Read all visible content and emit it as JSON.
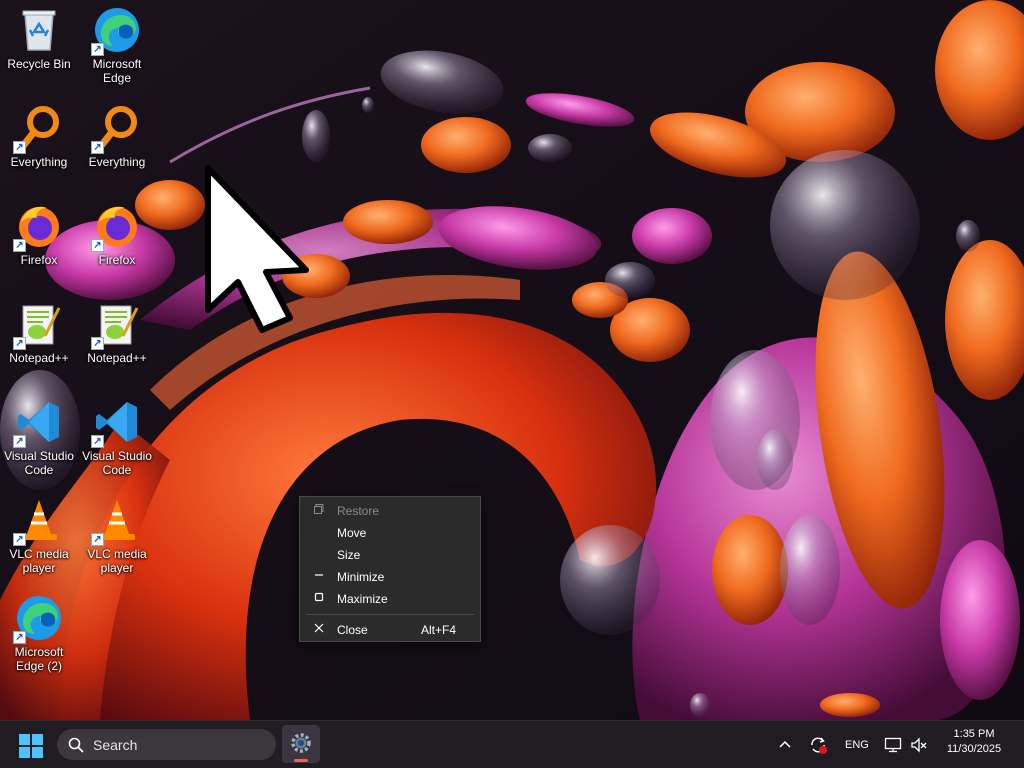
{
  "desktop": {
    "icons": [
      {
        "label": "Recycle Bin",
        "icon": "recycle-bin-icon"
      },
      {
        "label": "Microsoft Edge",
        "icon": "edge-icon"
      },
      {
        "label": "Everything",
        "icon": "everything-icon"
      },
      {
        "label": "Everything",
        "icon": "everything-icon"
      },
      {
        "label": "Firefox",
        "icon": "firefox-icon"
      },
      {
        "label": "Firefox",
        "icon": "firefox-icon"
      },
      {
        "label": "Notepad++",
        "icon": "notepadpp-icon"
      },
      {
        "label": "Notepad++",
        "icon": "notepadpp-icon"
      },
      {
        "label": "Visual Studio Code",
        "icon": "vscode-icon"
      },
      {
        "label": "Visual Studio Code",
        "icon": "vscode-icon"
      },
      {
        "label": "VLC media player",
        "icon": "vlc-icon"
      },
      {
        "label": "VLC media player",
        "icon": "vlc-icon"
      },
      {
        "label": "Microsoft Edge (2)",
        "icon": "edge-icon"
      }
    ],
    "shortcut_arrow": "↗"
  },
  "context_menu": {
    "items": [
      {
        "label": "Restore",
        "icon": "restore-icon",
        "disabled": true
      },
      {
        "label": "Move",
        "icon": "",
        "disabled": false
      },
      {
        "label": "Size",
        "icon": "",
        "disabled": false
      },
      {
        "label": "Minimize",
        "icon": "minimize-icon",
        "disabled": false
      },
      {
        "label": "Maximize",
        "icon": "maximize-icon",
        "disabled": false
      },
      {
        "label": "Close",
        "icon": "close-icon",
        "accelerator": "Alt+F4",
        "disabled": false
      }
    ]
  },
  "taskbar": {
    "search_label": "Search",
    "language": "ENG",
    "time": "1:35 PM",
    "date": "11/30/2025",
    "accent_color": "#e8644a",
    "start_color": "#4cc2ff"
  }
}
